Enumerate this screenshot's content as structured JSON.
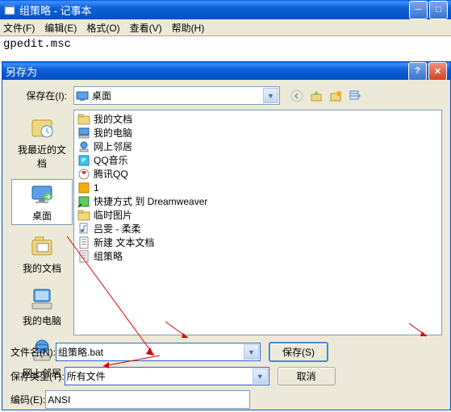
{
  "notepad": {
    "title": "组策略 - 记事本",
    "menus": {
      "file": "文件(F)",
      "edit": "编辑(E)",
      "format": "格式(O)",
      "view": "查看(V)",
      "help": "帮助(H)"
    },
    "content": "gpedit.msc"
  },
  "dialog": {
    "title": "另存为",
    "save_in_label": "保存在(I):",
    "save_in_value": "桌面",
    "sidebar": [
      {
        "label": "我最近的文档"
      },
      {
        "label": "桌面"
      },
      {
        "label": "我的文档"
      },
      {
        "label": "我的电脑"
      },
      {
        "label": "网上邻居"
      }
    ],
    "files": [
      "我的文档",
      "我的电脑",
      "网上邻居",
      "QQ音乐",
      "腾讯QQ",
      "1",
      "快捷方式 到 Dreamweaver",
      "临时图片",
      "吕雯 - 柔柔",
      "新建 文本文档",
      "组策略"
    ],
    "filename_label": "文件名(N):",
    "filename_value": "组策略.bat",
    "filetype_label": "保存类型(T):",
    "filetype_value": "所有文件",
    "encoding_label": "编码(E):",
    "encoding_value": "ANSI",
    "save_btn": "保存(S)",
    "cancel_btn": "取消"
  }
}
